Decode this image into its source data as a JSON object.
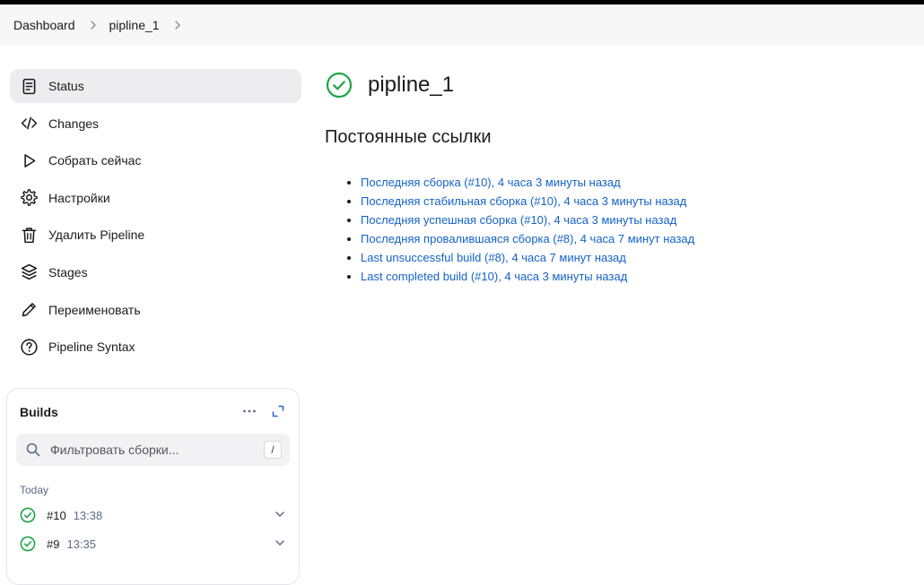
{
  "breadcrumb": {
    "items": [
      "Dashboard",
      "pipline_1"
    ]
  },
  "sidebar": {
    "items": [
      {
        "label": "Status",
        "icon": "document-icon",
        "active": true
      },
      {
        "label": "Changes",
        "icon": "code-icon",
        "active": false
      },
      {
        "label": "Собрать сейчас",
        "icon": "play-icon",
        "active": false
      },
      {
        "label": "Настройки",
        "icon": "gear-icon",
        "active": false
      },
      {
        "label": "Удалить Pipeline",
        "icon": "trash-icon",
        "active": false
      },
      {
        "label": "Stages",
        "icon": "layers-icon",
        "active": false
      },
      {
        "label": "Переименовать",
        "icon": "pencil-icon",
        "active": false
      },
      {
        "label": "Pipeline Syntax",
        "icon": "help-icon",
        "active": false
      }
    ]
  },
  "builds": {
    "title": "Builds",
    "filter_placeholder": "Фильтровать сборки...",
    "shortcut": "/",
    "group_label": "Today",
    "rows": [
      {
        "number": "#10",
        "time": "13:38",
        "status": "success"
      },
      {
        "number": "#9",
        "time": "13:35",
        "status": "success"
      }
    ]
  },
  "main": {
    "title": "pipline_1",
    "section_title": "Постоянные ссылки",
    "permalinks": [
      "Последняя сборка (#10), 4 часа 3 минуты назад",
      "Последняя стабильная сборка (#10), 4 часа 3 минуты назад",
      "Последняя успешная сборка (#10), 4 часа 3 минуты назад",
      "Последняя провалившаяся сборка (#8), 4 часа 7 минут назад",
      "Last unsuccessful build (#8), 4 часа 7 минут назад",
      "Last completed build (#10), 4 часа 3 минуты назад"
    ]
  },
  "colors": {
    "success": "#1ea446",
    "link": "#1463c8",
    "active_bg": "#ededf0"
  }
}
